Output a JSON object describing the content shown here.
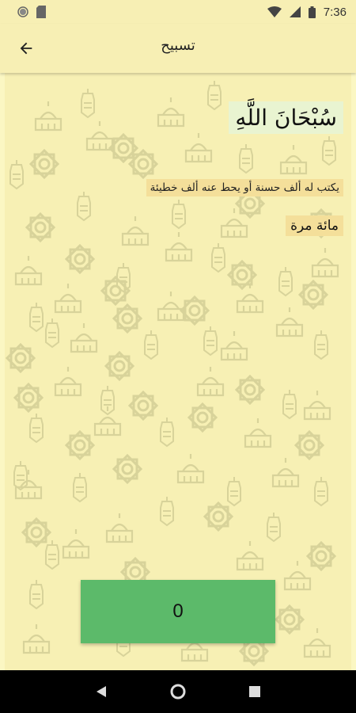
{
  "status_bar": {
    "time": "7:36",
    "icons": [
      "notification-dot-icon",
      "sim-card-icon",
      "wifi-icon",
      "signal-icon",
      "battery-icon"
    ]
  },
  "app_bar": {
    "title": "تسبيح",
    "back_icon": "arrow-back-icon"
  },
  "dhikr": {
    "text": "سُبْحَانَ اللَّهِ",
    "virtue": "يكتب له ألف حسنة أو يحط عنه ألف خطيئة",
    "times": "مائة مرة"
  },
  "counter": {
    "value": "0"
  },
  "colors": {
    "background": "#f7f0b4",
    "dhikr_highlight": "#e9f4d1",
    "label_highlight": "#f4df9a",
    "counter_button": "#5cba6a",
    "pattern": "#d6d19a"
  },
  "nav_bar": {
    "icons": [
      "back-triangle-icon",
      "home-circle-icon",
      "recents-square-icon"
    ]
  }
}
